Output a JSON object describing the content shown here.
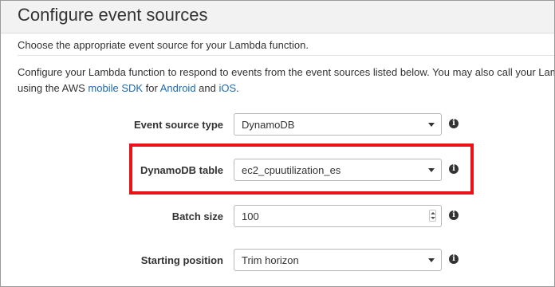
{
  "page": {
    "title": "Configure event sources",
    "subtitle": "Choose the appropriate event source for your Lambda function.",
    "description": {
      "line1": "Configure your Lambda function to respond to events from the event sources listed below. You may also call your Lambda",
      "line2_prefix": "using the AWS ",
      "mobile_sdk_link": "mobile SDK",
      "for_text": " for ",
      "android_link": "Android",
      "and_text": " and ",
      "ios_link": "iOS",
      "period": "."
    }
  },
  "form": {
    "event_source_type": {
      "label": "Event source type",
      "value": "DynamoDB"
    },
    "dynamodb_table": {
      "label": "DynamoDB table",
      "value": "ec2_cpuutilization_es"
    },
    "batch_size": {
      "label": "Batch size",
      "value": "100"
    },
    "starting_position": {
      "label": "Starting position",
      "value": "Trim horizon"
    }
  },
  "icons": {
    "info": "info-icon",
    "dropdown": "caret-down-icon",
    "stepper": "up-down-stepper-icon"
  },
  "colors": {
    "header_background": "#f2f2f2",
    "link": "#1a6bb2",
    "highlight_border": "#e8121b"
  }
}
